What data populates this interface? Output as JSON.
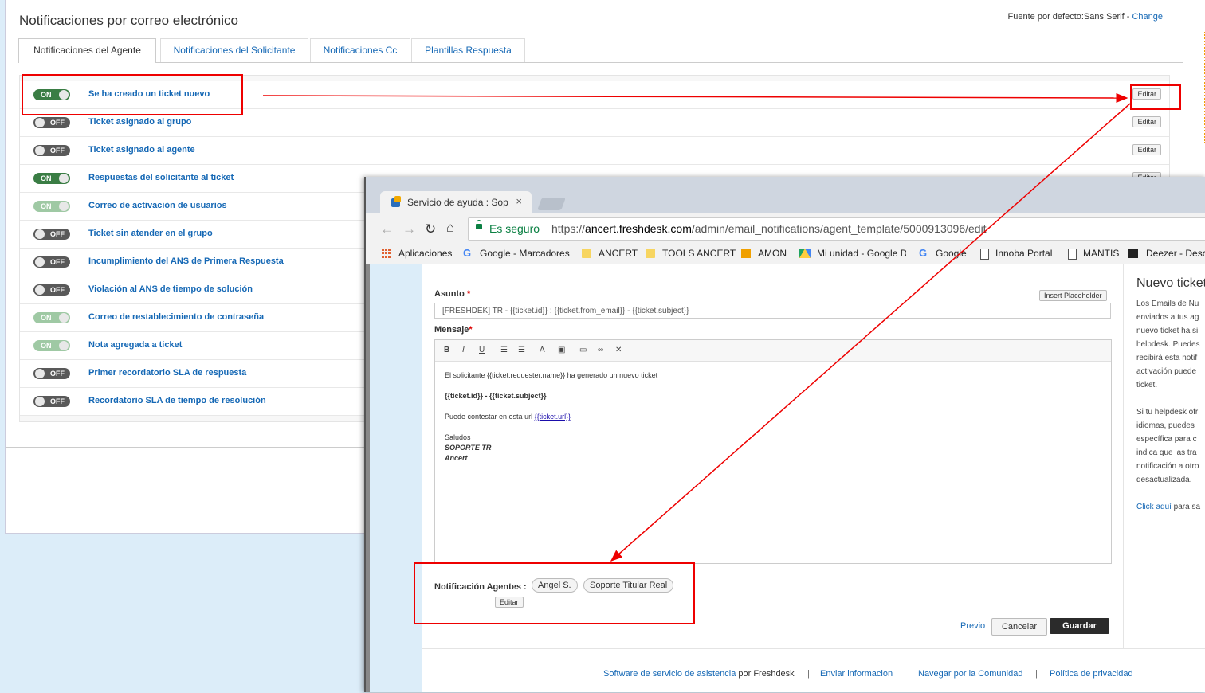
{
  "page": {
    "title": "Notificaciones por correo electrónico",
    "font_label": "Fuente por defecto:Sans Serif - ",
    "font_change": "Change"
  },
  "tabs": [
    "Notificaciones del Agente",
    "Notificaciones del Solicitante",
    "Notificaciones Cc",
    "Plantillas Respuesta"
  ],
  "notifications": [
    {
      "state": "ON",
      "label": "Se ha creado un ticket nuevo"
    },
    {
      "state": "OFF",
      "label": "Ticket asignado al grupo"
    },
    {
      "state": "OFF",
      "label": "Ticket asignado al agente"
    },
    {
      "state": "ON",
      "label": "Respuestas del solicitante al ticket"
    },
    {
      "state": "ON",
      "label": "Correo de activación de usuarios",
      "faded": true
    },
    {
      "state": "OFF",
      "label": "Ticket sin atender en el grupo"
    },
    {
      "state": "OFF",
      "label": "Incumplimiento del ANS de Primera Respuesta"
    },
    {
      "state": "OFF",
      "label": "Violación al ANS de tiempo de solución"
    },
    {
      "state": "ON",
      "label": "Correo de restablecimiento de contraseña",
      "faded": true
    },
    {
      "state": "ON",
      "label": "Nota agregada a ticket",
      "faded": true
    },
    {
      "state": "OFF",
      "label": "Primer recordatorio SLA de respuesta"
    },
    {
      "state": "OFF",
      "label": "Recordatorio SLA de tiempo de resolución"
    }
  ],
  "edit_label": "Editar",
  "browser": {
    "tab_title": "Servicio de ayuda : Soporte",
    "tab_close": "×",
    "secure_label": "Es seguro",
    "url_scheme": "https://",
    "url_domain": "ancert.freshdesk.com",
    "url_path": "/admin/email_notifications/agent_template/5000913096/edit",
    "bookmarks": [
      "Aplicaciones",
      "Google - Marcadores",
      "ANCERT",
      "TOOLS ANCERT",
      "AMON",
      "Mi unidad - Google D",
      "Google",
      "Innoba Portal",
      "MANTIS",
      "Deezer - Desc"
    ]
  },
  "form": {
    "subject_label": "Asunto",
    "insert_placeholder": "Insert Placeholder",
    "subject_value": "[FRESHDEK]  TR -  {{ticket.id}} : {{ticket.from_email}} - {{ticket.subject}}",
    "message_label": "Mensaje",
    "required_mark": "*",
    "body_line1": "El solicitante {{ticket.requester.name}} ha generado un nuevo ticket",
    "body_line2": "{{ticket.id}} - {{ticket.subject}}",
    "body_line3": "Puede contestar en esta url  ",
    "body_link": "{{ticket.url}}",
    "body_saludos": "Saludos",
    "body_sig1": "SOPORTE TR",
    "body_sig2": "Ancert",
    "agents_label": "Notificación Agentes :",
    "agents": [
      "Angel S.",
      "Soporte Titular Real"
    ],
    "edit_label": "Editar",
    "prev_label": "Previo",
    "cancel_label": "Cancelar",
    "save_label": "Guardar"
  },
  "side_panel": {
    "title": "Nuevo ticket",
    "para1": "Los Emails de Nu enviados a tus ag nuevo ticket ha si helpdesk. Puedes recibirá esta notif activación puede ticket.",
    "para2": "Si tu helpdesk ofr idiomas, puedes específica para c indica que las tra notificación a otro desactualizada.",
    "link": "Click aquí",
    "link_suffix": " para sa"
  },
  "footer": {
    "software_link": "Software de servicio de asistencia",
    "by": " por Freshdesk",
    "feedback": "Enviar informacion",
    "community": "Navegar por la Comunidad",
    "privacy": "Política de privacidad",
    "sep": "|"
  },
  "colors": {
    "link": "#1568b5",
    "toggle_on": "#3a7d44",
    "toggle_off": "#595959",
    "annotation": "#e00000"
  }
}
